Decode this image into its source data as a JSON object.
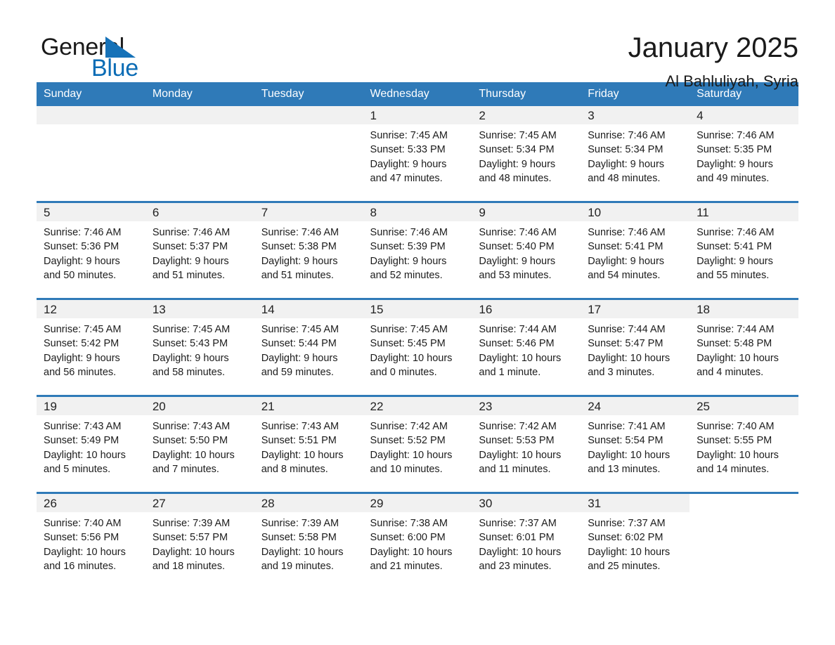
{
  "logo": {
    "word_one": "General",
    "word_two": "Blue",
    "triangle_icon": "triangle-icon"
  },
  "header": {
    "title": "January 2025",
    "location": "Al Bahluliyah, Syria"
  },
  "calendar": {
    "weekday_headers": [
      "Sunday",
      "Monday",
      "Tuesday",
      "Wednesday",
      "Thursday",
      "Friday",
      "Saturday"
    ],
    "accent_color": "#2f7ab8",
    "band_color": "#f1f1f1",
    "weeks": [
      [
        {
          "day": "",
          "lines": []
        },
        {
          "day": "",
          "lines": []
        },
        {
          "day": "",
          "lines": []
        },
        {
          "day": "1",
          "lines": [
            "Sunrise: 7:45 AM",
            "Sunset: 5:33 PM",
            "Daylight: 9 hours",
            "and 47 minutes."
          ]
        },
        {
          "day": "2",
          "lines": [
            "Sunrise: 7:45 AM",
            "Sunset: 5:34 PM",
            "Daylight: 9 hours",
            "and 48 minutes."
          ]
        },
        {
          "day": "3",
          "lines": [
            "Sunrise: 7:46 AM",
            "Sunset: 5:34 PM",
            "Daylight: 9 hours",
            "and 48 minutes."
          ]
        },
        {
          "day": "4",
          "lines": [
            "Sunrise: 7:46 AM",
            "Sunset: 5:35 PM",
            "Daylight: 9 hours",
            "and 49 minutes."
          ]
        }
      ],
      [
        {
          "day": "5",
          "lines": [
            "Sunrise: 7:46 AM",
            "Sunset: 5:36 PM",
            "Daylight: 9 hours",
            "and 50 minutes."
          ]
        },
        {
          "day": "6",
          "lines": [
            "Sunrise: 7:46 AM",
            "Sunset: 5:37 PM",
            "Daylight: 9 hours",
            "and 51 minutes."
          ]
        },
        {
          "day": "7",
          "lines": [
            "Sunrise: 7:46 AM",
            "Sunset: 5:38 PM",
            "Daylight: 9 hours",
            "and 51 minutes."
          ]
        },
        {
          "day": "8",
          "lines": [
            "Sunrise: 7:46 AM",
            "Sunset: 5:39 PM",
            "Daylight: 9 hours",
            "and 52 minutes."
          ]
        },
        {
          "day": "9",
          "lines": [
            "Sunrise: 7:46 AM",
            "Sunset: 5:40 PM",
            "Daylight: 9 hours",
            "and 53 minutes."
          ]
        },
        {
          "day": "10",
          "lines": [
            "Sunrise: 7:46 AM",
            "Sunset: 5:41 PM",
            "Daylight: 9 hours",
            "and 54 minutes."
          ]
        },
        {
          "day": "11",
          "lines": [
            "Sunrise: 7:46 AM",
            "Sunset: 5:41 PM",
            "Daylight: 9 hours",
            "and 55 minutes."
          ]
        }
      ],
      [
        {
          "day": "12",
          "lines": [
            "Sunrise: 7:45 AM",
            "Sunset: 5:42 PM",
            "Daylight: 9 hours",
            "and 56 minutes."
          ]
        },
        {
          "day": "13",
          "lines": [
            "Sunrise: 7:45 AM",
            "Sunset: 5:43 PM",
            "Daylight: 9 hours",
            "and 58 minutes."
          ]
        },
        {
          "day": "14",
          "lines": [
            "Sunrise: 7:45 AM",
            "Sunset: 5:44 PM",
            "Daylight: 9 hours",
            "and 59 minutes."
          ]
        },
        {
          "day": "15",
          "lines": [
            "Sunrise: 7:45 AM",
            "Sunset: 5:45 PM",
            "Daylight: 10 hours",
            "and 0 minutes."
          ]
        },
        {
          "day": "16",
          "lines": [
            "Sunrise: 7:44 AM",
            "Sunset: 5:46 PM",
            "Daylight: 10 hours",
            "and 1 minute."
          ]
        },
        {
          "day": "17",
          "lines": [
            "Sunrise: 7:44 AM",
            "Sunset: 5:47 PM",
            "Daylight: 10 hours",
            "and 3 minutes."
          ]
        },
        {
          "day": "18",
          "lines": [
            "Sunrise: 7:44 AM",
            "Sunset: 5:48 PM",
            "Daylight: 10 hours",
            "and 4 minutes."
          ]
        }
      ],
      [
        {
          "day": "19",
          "lines": [
            "Sunrise: 7:43 AM",
            "Sunset: 5:49 PM",
            "Daylight: 10 hours",
            "and 5 minutes."
          ]
        },
        {
          "day": "20",
          "lines": [
            "Sunrise: 7:43 AM",
            "Sunset: 5:50 PM",
            "Daylight: 10 hours",
            "and 7 minutes."
          ]
        },
        {
          "day": "21",
          "lines": [
            "Sunrise: 7:43 AM",
            "Sunset: 5:51 PM",
            "Daylight: 10 hours",
            "and 8 minutes."
          ]
        },
        {
          "day": "22",
          "lines": [
            "Sunrise: 7:42 AM",
            "Sunset: 5:52 PM",
            "Daylight: 10 hours",
            "and 10 minutes."
          ]
        },
        {
          "day": "23",
          "lines": [
            "Sunrise: 7:42 AM",
            "Sunset: 5:53 PM",
            "Daylight: 10 hours",
            "and 11 minutes."
          ]
        },
        {
          "day": "24",
          "lines": [
            "Sunrise: 7:41 AM",
            "Sunset: 5:54 PM",
            "Daylight: 10 hours",
            "and 13 minutes."
          ]
        },
        {
          "day": "25",
          "lines": [
            "Sunrise: 7:40 AM",
            "Sunset: 5:55 PM",
            "Daylight: 10 hours",
            "and 14 minutes."
          ]
        }
      ],
      [
        {
          "day": "26",
          "lines": [
            "Sunrise: 7:40 AM",
            "Sunset: 5:56 PM",
            "Daylight: 10 hours",
            "and 16 minutes."
          ]
        },
        {
          "day": "27",
          "lines": [
            "Sunrise: 7:39 AM",
            "Sunset: 5:57 PM",
            "Daylight: 10 hours",
            "and 18 minutes."
          ]
        },
        {
          "day": "28",
          "lines": [
            "Sunrise: 7:39 AM",
            "Sunset: 5:58 PM",
            "Daylight: 10 hours",
            "and 19 minutes."
          ]
        },
        {
          "day": "29",
          "lines": [
            "Sunrise: 7:38 AM",
            "Sunset: 6:00 PM",
            "Daylight: 10 hours",
            "and 21 minutes."
          ]
        },
        {
          "day": "30",
          "lines": [
            "Sunrise: 7:37 AM",
            "Sunset: 6:01 PM",
            "Daylight: 10 hours",
            "and 23 minutes."
          ]
        },
        {
          "day": "31",
          "lines": [
            "Sunrise: 7:37 AM",
            "Sunset: 6:02 PM",
            "Daylight: 10 hours",
            "and 25 minutes."
          ]
        },
        {
          "day": "",
          "lines": []
        }
      ]
    ]
  }
}
